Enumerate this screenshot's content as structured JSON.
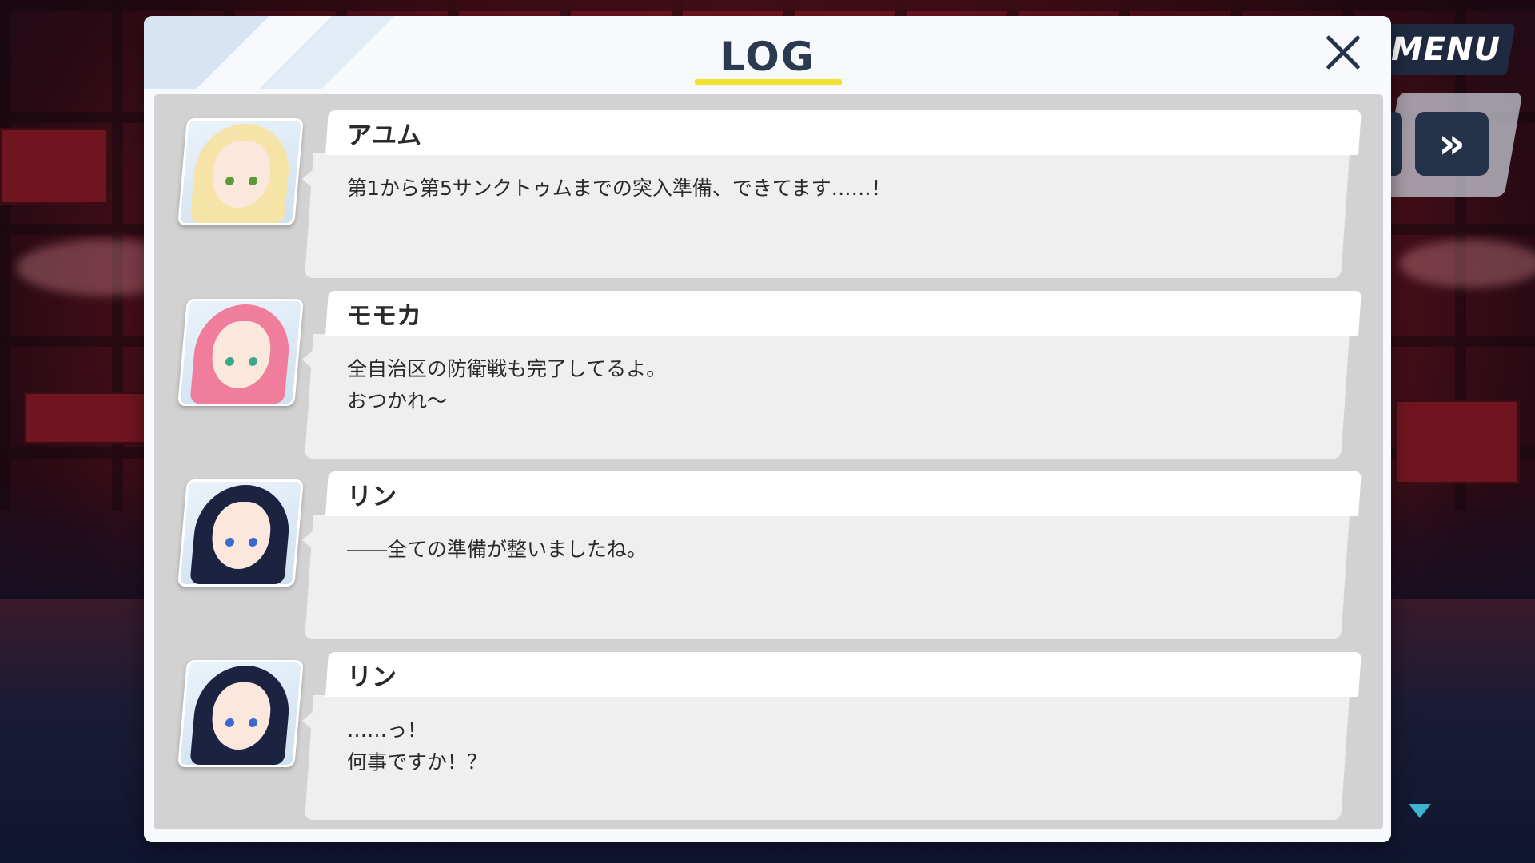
{
  "hud": {
    "menu_label": "MENU",
    "skip_symbol": "»",
    "skip_icon": "fast-forward-icon",
    "next_icon": "triangle-down-icon"
  },
  "dialog": {
    "title": "LOG",
    "close_icon": "close-icon",
    "accent_color": "#f3e130"
  },
  "entries": [
    {
      "speaker": "アユム",
      "lines": [
        "第1から第5サンクトゥムまでの突入準備、できてます……！",
        ""
      ],
      "portrait": "blonde"
    },
    {
      "speaker": "モモカ",
      "lines": [
        "全自治区の防衛戦も完了してるよ。",
        "おつかれ～"
      ],
      "portrait": "pink"
    },
    {
      "speaker": "リン",
      "lines": [
        "――全ての準備が整いましたね。",
        ""
      ],
      "portrait": "dark"
    },
    {
      "speaker": "リン",
      "lines": [
        "……っ！",
        "何事ですか！？"
      ],
      "portrait": "dark"
    }
  ]
}
